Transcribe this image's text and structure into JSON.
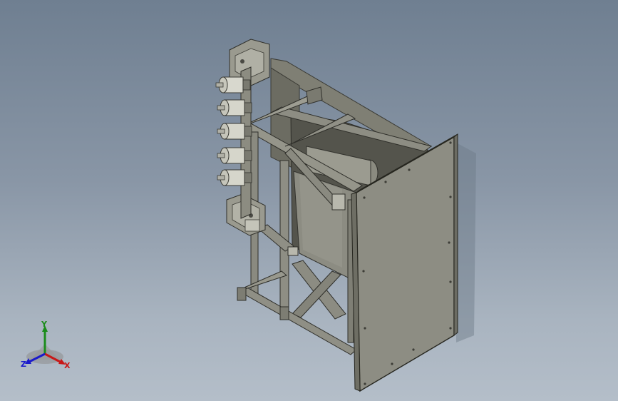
{
  "viewport": {
    "background_top": "#6f7f91",
    "background_bottom": "#b4bec9",
    "model_color": "#8a8a80"
  },
  "triad": {
    "x_label": "X",
    "y_label": "Y",
    "z_label": "Z",
    "x_color": "#c81818",
    "y_color": "#1b8c1b",
    "z_color": "#1a1acb"
  }
}
